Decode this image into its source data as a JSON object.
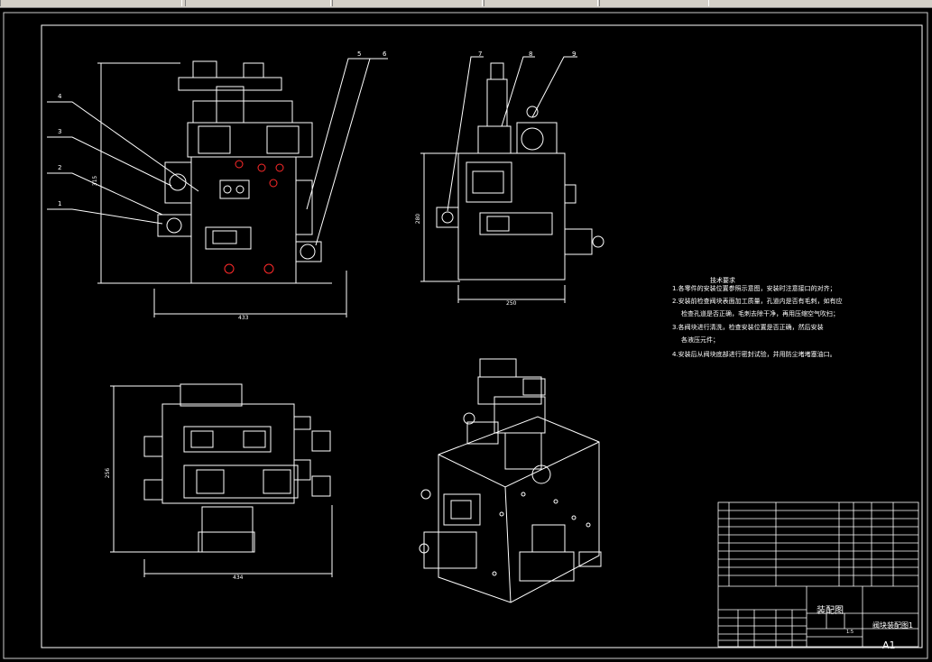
{
  "drawing": {
    "tech_req_title": "技术要求",
    "tech_req": [
      "1.各零件的安装位置参照示意图，安装时注意接口的对齐；",
      "2.安装前检查阀块表面加工质量，孔道内是否有毛刺，如有应",
      "检查孔道是否正确，毛刺去除干净，再用压缩空气吹扫；",
      "3.各阀块进行清洗，检查安装位置是否正确，然后安装",
      "各液压元件；",
      "4.安装后从阀块底部进行密封试验，并用防尘堵堵塞油口。"
    ],
    "dims": {
      "front_height": "315",
      "front_width": "433",
      "side_height": "280",
      "side_width": "250",
      "top_height": "256",
      "top_width": "434"
    },
    "balloons": [
      "1",
      "2",
      "3",
      "4",
      "5",
      "6",
      "7",
      "8",
      "9"
    ],
    "title_block": {
      "title": "装配图",
      "name": "阀块装配图1",
      "size": "A1",
      "scale": "1:5"
    }
  },
  "colors": {
    "line": "#ffffff",
    "accent": "#ff2a2a",
    "toolbar": "#d4d0c8"
  }
}
